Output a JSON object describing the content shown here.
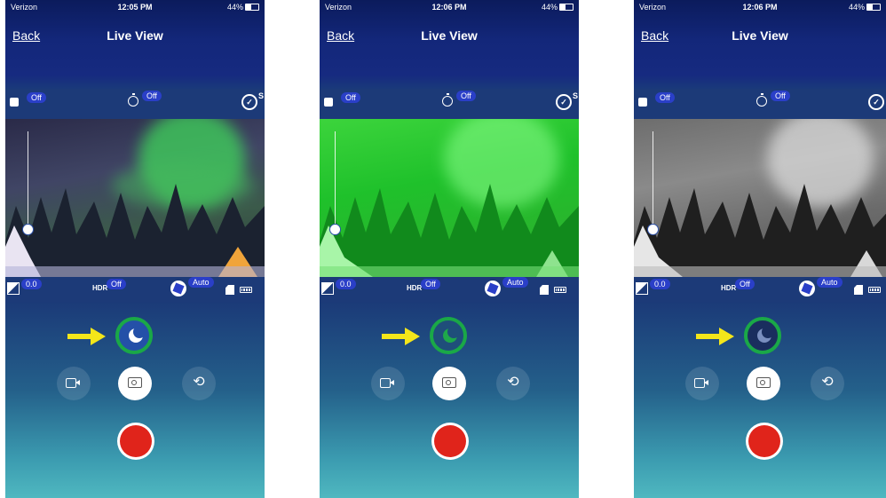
{
  "screens": [
    {
      "status": {
        "carrier": "Verizon",
        "time": "12:05 PM",
        "battery": "44%"
      },
      "nav": {
        "back": "Back",
        "title": "Live View"
      },
      "top_controls": {
        "square_badge": "Off",
        "timer_badge": "Off",
        "scene_letter": "S"
      },
      "bottom_controls": {
        "ev_value": "0.0",
        "hdr_label": "HDR",
        "hdr_badge": "Off",
        "aperture_badge": "Auto"
      },
      "night_mode": "color",
      "colors": {
        "night_ring": "#1aa847",
        "record": "#e0241b",
        "arrow": "#f4e61a"
      }
    },
    {
      "status": {
        "carrier": "Verizon",
        "time": "12:06 PM",
        "battery": "44%"
      },
      "nav": {
        "back": "Back",
        "title": "Live View"
      },
      "top_controls": {
        "square_badge": "Off",
        "timer_badge": "Off",
        "scene_letter": "S"
      },
      "bottom_controls": {
        "ev_value": "0.0",
        "hdr_label": "HDR",
        "hdr_badge": "Off",
        "aperture_badge": "Auto"
      },
      "night_mode": "green",
      "colors": {
        "night_ring": "#1aa847",
        "record": "#e0241b",
        "arrow": "#f4e61a"
      }
    },
    {
      "status": {
        "carrier": "Verizon",
        "time": "12:06 PM",
        "battery": "44%"
      },
      "nav": {
        "back": "Back",
        "title": "Live View"
      },
      "top_controls": {
        "square_badge": "Off",
        "timer_badge": "Off",
        "scene_letter": "S"
      },
      "bottom_controls": {
        "ev_value": "0.0",
        "hdr_label": "HDR",
        "hdr_badge": "Off",
        "aperture_badge": "Auto"
      },
      "night_mode": "monochrome",
      "colors": {
        "night_ring": "#1aa847",
        "record": "#e0241b",
        "arrow": "#f4e61a"
      }
    }
  ],
  "icons": [
    "signal-icon",
    "wifi-icon",
    "location-icon",
    "battery-icon",
    "square-icon",
    "timer-icon",
    "scene-icon",
    "ev-icon",
    "aperture-icon",
    "sd-card-icon",
    "camera-battery-icon",
    "moon-icon",
    "arrow-icon",
    "video-icon",
    "camera-icon",
    "loop-icon",
    "record-icon"
  ]
}
